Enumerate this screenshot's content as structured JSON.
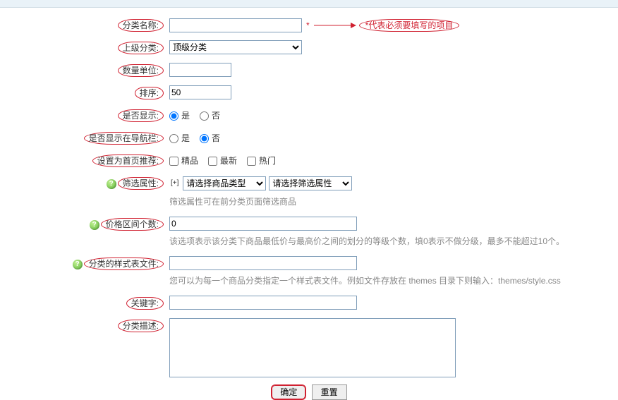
{
  "annotation": {
    "star": "*",
    "note": "*代表必须要填写的项目"
  },
  "labels": {
    "category_name": "分类名称:",
    "parent_category": "上级分类:",
    "quantity_unit": "数量单位:",
    "sort": "排序:",
    "is_show": "是否显示:",
    "show_in_nav": "是否显示在导航栏:",
    "set_home_rec": "设置为首页推荐:",
    "filter_attr": "筛选属性:",
    "price_range_count": "价格区间个数:",
    "style_file": "分类的样式表文件:",
    "keywords": "关键字:",
    "description": "分类描述:"
  },
  "fields": {
    "category_name": "",
    "parent_category_selected": "顶级分类",
    "parent_category_options": [
      "顶级分类"
    ],
    "quantity_unit": "",
    "sort": "50",
    "is_show": "是",
    "show_in_nav": "否",
    "yes": "是",
    "no": "否",
    "rec_jingpin": "精品",
    "rec_zuixin": "最新",
    "rec_remen": "热门",
    "plus_label": "[+]",
    "goods_type_selected": "请选择商品类型",
    "goods_type_options": [
      "请选择商品类型"
    ],
    "filter_attr_selected": "请选择筛选属性",
    "filter_attr_options": [
      "请选择筛选属性"
    ],
    "filter_attr_hint": "筛选属性可在前分类页面筛选商品",
    "price_range_count": "0",
    "price_range_hint": "该选项表示该分类下商品最低价与最高价之间的划分的等级个数，填0表示不做分级，最多不能超过10个。",
    "style_file": "",
    "style_file_hint": "您可以为每一个商品分类指定一个样式表文件。例如文件存放在 themes 目录下则输入：themes/style.css",
    "keywords": "",
    "description": ""
  },
  "buttons": {
    "submit": "确定",
    "reset": "重置"
  }
}
